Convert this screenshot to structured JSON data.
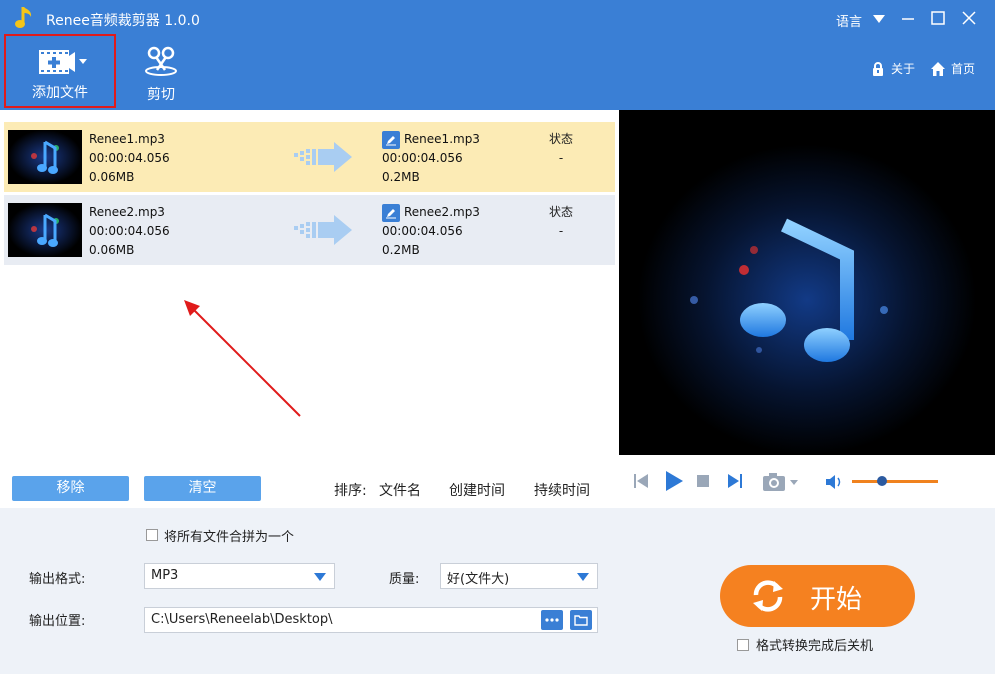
{
  "window": {
    "title": "Renee音频裁剪器 1.0.0",
    "language_label": "语言"
  },
  "toolbar": {
    "add_file_label": "添加文件",
    "cut_label": "剪切",
    "about_label": "关于",
    "home_label": "首页"
  },
  "files": [
    {
      "src_name": "Renee1.mp3",
      "src_duration": "00:00:04.056",
      "src_size": "0.06MB",
      "dst_name": "Renee1.mp3",
      "dst_duration": "00:00:04.056",
      "dst_size": "0.2MB",
      "status_label": "状态",
      "status_value": "-",
      "selected": true
    },
    {
      "src_name": "Renee2.mp3",
      "src_duration": "00:00:04.056",
      "src_size": "0.06MB",
      "dst_name": "Renee2.mp3",
      "dst_duration": "00:00:04.056",
      "dst_size": "0.2MB",
      "status_label": "状态",
      "status_value": "-",
      "selected": false
    }
  ],
  "list_actions": {
    "remove_label": "移除",
    "clear_label": "清空",
    "sort_label": "排序:",
    "sort_options": [
      "文件名",
      "创建时间",
      "持续时间"
    ]
  },
  "player": {
    "volume": 0.35
  },
  "settings": {
    "merge_label": "将所有文件合拼为一个",
    "merge_checked": false,
    "format_label": "输出格式:",
    "format_value": "MP3",
    "quality_label": "质量:",
    "quality_value": "好(文件大)",
    "location_label": "输出位置:",
    "location_value": "C:\\Users\\Reneelab\\Desktop\\",
    "start_label": "开始",
    "shutdown_label": "格式转换完成后关机",
    "shutdown_checked": false
  },
  "colors": {
    "primary": "#3a7fd5",
    "accent": "#f58120",
    "selected_row": "#fcebb5",
    "annotation": "#e01b1b"
  }
}
